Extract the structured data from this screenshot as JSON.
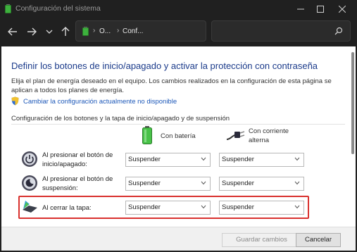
{
  "window": {
    "title": "Configuración del sistema",
    "minimize_icon": "minimize-icon",
    "maximize_icon": "maximize-icon",
    "close_icon": "close-icon"
  },
  "nav": {
    "back_icon": "back-arrow-icon",
    "forward_icon": "forward-arrow-icon",
    "recent_icon": "chevron-down-icon",
    "up_icon": "up-arrow-icon"
  },
  "address": {
    "part1": "O...",
    "part2": "Conf...",
    "separator": "›"
  },
  "search": {
    "placeholder": ""
  },
  "page": {
    "heading": "Definir los botones de inicio/apagado y activar la protección con contraseña",
    "description": "Elija el plan de energía deseado en el equipo. Los cambios realizados en la configuración de esta página se aplican a todos los planes de energía.",
    "change_link": "Cambiar la configuración actualmente no disponible",
    "section_title": "Configuración de los botones y la tapa de inicio/apagado y de suspensión"
  },
  "columns": {
    "battery": "Con batería",
    "ac_line1": "Con corriente",
    "ac_line2": "alterna"
  },
  "rows": [
    {
      "label_line1": "Al presionar el botón de",
      "label_line2": "inicio/apagado:",
      "battery": "Suspender",
      "ac": "Suspender"
    },
    {
      "label_line1": "Al presionar el botón de",
      "label_line2": "suspensión:",
      "battery": "Suspender",
      "ac": "Suspender"
    },
    {
      "label_line1": "Al cerrar la tapa:",
      "label_line2": "",
      "battery": "Suspender",
      "ac": "Suspender"
    }
  ],
  "footer": {
    "save_label": "Guardar cambios",
    "cancel_label": "Cancelar"
  },
  "colors": {
    "highlight": "#d9312e",
    "heading": "#1a3a8a",
    "link": "#1a56b8"
  }
}
